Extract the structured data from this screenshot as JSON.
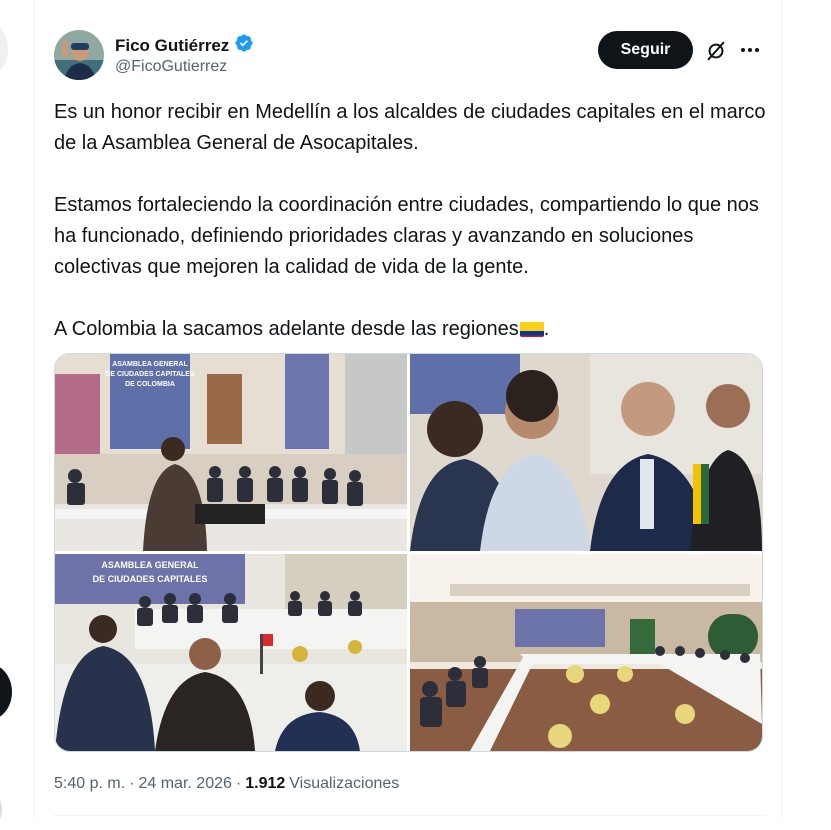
{
  "author": {
    "name": "Fico Gutiérrez",
    "handle": "@FicoGutierrez",
    "verified": true,
    "avatar": "avatar"
  },
  "actions": {
    "follow_label": "Seguir",
    "grok_icon": "grok-icon",
    "more_icon": "more-icon"
  },
  "tweet": {
    "paragraphs": [
      "Es un honor recibir en Medellín a los alcaldes de ciudades capitales en el marco de la Asamblea General de Asocapitales.",
      "Estamos fortaleciendo la coordinación entre ciudades, compartiendo lo que nos ha funcionado, definiendo prioridades claras y avanzando en soluciones colectivas que mejoren la calidad de vida de la gente.",
      "A Colombia la sacamos adelante desde las regiones",
      "."
    ],
    "flag_emoji": "colombia-flag"
  },
  "media": {
    "banner_text_1": "ASAMBLEA GENERAL DE CIUDADES CAPITALES DE COLOMBIA",
    "banner_text_2": "ASAMBLEA GENERAL DE CIUDADES CAPITALES DE COLOMBIA"
  },
  "meta": {
    "time": "5:40 p. m.",
    "sep1": "·",
    "date": "24 mar. 2026",
    "sep2": "·",
    "views_count": "1.912",
    "views_label": "Visualizaciones"
  },
  "colors": {
    "text": "#0f1419",
    "secondary": "#536471",
    "verified": "#1d9bf0",
    "button": "#0f1419"
  }
}
